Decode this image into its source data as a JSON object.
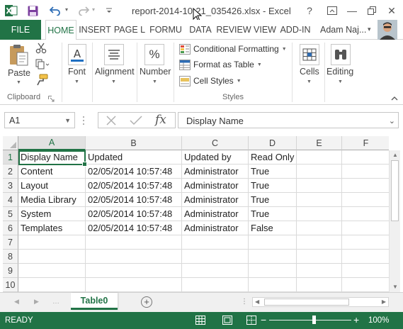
{
  "window": {
    "title": "report-2014-10-21_035426.xlsx - Excel",
    "help": "?",
    "minimize": "—",
    "close": "✕"
  },
  "qat": {
    "undo_caret": "▾",
    "redo_caret": "▾"
  },
  "tabs": {
    "file": "FILE",
    "items": [
      "HOME",
      "INSERT",
      "PAGE L",
      "FORMU",
      "DATA",
      "REVIEW",
      "VIEW",
      "ADD-IN"
    ],
    "active": "HOME"
  },
  "user": {
    "name": "Adam Naj...",
    "caret": "▾"
  },
  "ribbon": {
    "paste": "Paste",
    "clipboard_group": "Clipboard",
    "font": "Font",
    "alignment": "Alignment",
    "number": "Number",
    "percent_glyph": "%",
    "conditional_formatting": "Conditional Formatting",
    "format_as_table": "Format as Table",
    "cell_styles": "Cell Styles",
    "styles_group": "Styles",
    "cells": "Cells",
    "editing": "Editing"
  },
  "formula_bar": {
    "name_box": "A1",
    "fx": "fx",
    "value": "Display Name"
  },
  "grid": {
    "columns": [
      "A",
      "B",
      "C",
      "D",
      "E",
      "F"
    ],
    "row_numbers": [
      "1",
      "2",
      "3",
      "4",
      "5",
      "6",
      "7",
      "8",
      "9",
      "10"
    ],
    "rows": [
      [
        "Display Name",
        "Updated",
        "Updated by",
        "Read Only",
        "",
        ""
      ],
      [
        "Content",
        "02/05/2014 10:57:48",
        "Administrator",
        "True",
        "",
        ""
      ],
      [
        "Layout",
        "02/05/2014 10:57:48",
        "Administrator",
        "True",
        "",
        ""
      ],
      [
        "Media Library",
        "02/05/2014 10:57:48",
        "Administrator",
        "True",
        "",
        ""
      ],
      [
        "System",
        "02/05/2014 10:57:48",
        "Administrator",
        "True",
        "",
        ""
      ],
      [
        "Templates",
        "02/05/2014 10:57:48",
        "Administrator",
        "False",
        "",
        ""
      ],
      [
        "",
        "",
        "",
        "",
        "",
        ""
      ],
      [
        "",
        "",
        "",
        "",
        "",
        ""
      ],
      [
        "",
        "",
        "",
        "",
        "",
        ""
      ],
      [
        "",
        "",
        "",
        "",
        "",
        ""
      ]
    ],
    "selected_cell": "A1"
  },
  "sheets": {
    "active": "Table0",
    "add": "+"
  },
  "status": {
    "text": "READY",
    "zoom": "100%",
    "zoom_minus": "−",
    "zoom_plus": "+"
  },
  "colors": {
    "accent": "#217346"
  }
}
